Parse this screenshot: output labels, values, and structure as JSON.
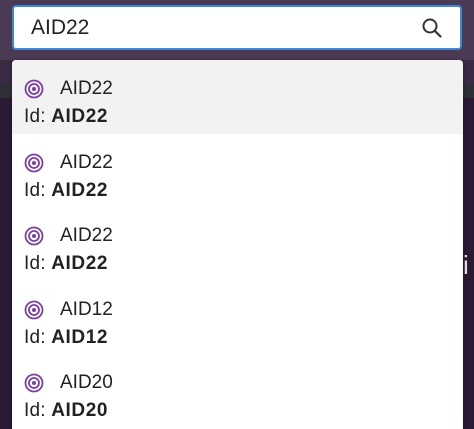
{
  "search": {
    "value": "AID22",
    "icon": "search-icon",
    "border_color": "#3b8ad8"
  },
  "results": [
    {
      "name": "AID22",
      "id_label": "Id:",
      "id": "AID22",
      "icon": "target-icon"
    },
    {
      "name": "AID22",
      "id_label": "Id:",
      "id": "AID22",
      "icon": "target-icon"
    },
    {
      "name": "AID22",
      "id_label": "Id:",
      "id": "AID22",
      "icon": "target-icon"
    },
    {
      "name": "AID12",
      "id_label": "Id:",
      "id": "AID12",
      "icon": "target-icon"
    },
    {
      "name": "AID20",
      "id_label": "Id:",
      "id": "AID20",
      "icon": "target-icon"
    }
  ],
  "colors": {
    "icon_accent": "#7b3fa3",
    "highlight_row": "#f2f2f2",
    "background": "#2b1a33"
  },
  "background_glyph": "i"
}
